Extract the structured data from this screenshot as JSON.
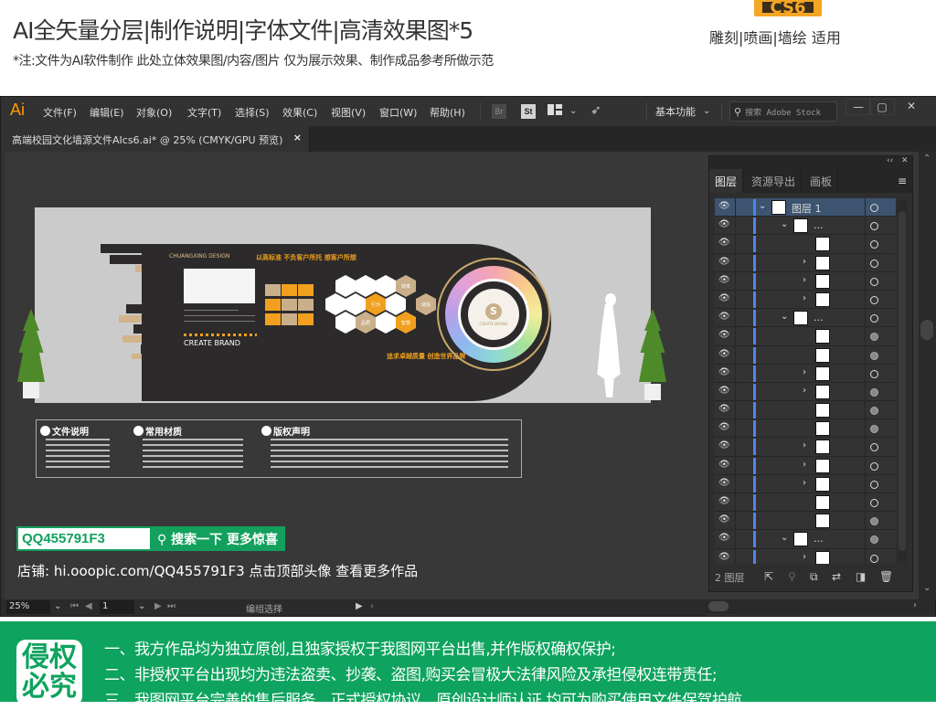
{
  "promo": {
    "title": "AI全矢量分层|制作说明|字体文件|高清效果图*5",
    "note": "*注:文件为AI软件制作 此处立体效果图/内容/图片 仅为展示效果、制作成品参考所做示范",
    "version_badge": "CS6",
    "usage": "雕刻|喷画|墙绘 适用"
  },
  "app": {
    "logo": "Ai",
    "menu": [
      "文件(F)",
      "编辑(E)",
      "对象(O)",
      "文字(T)",
      "选择(S)",
      "效果(C)",
      "视图(V)",
      "窗口(W)",
      "帮助(H)"
    ],
    "toolbar": {
      "bridge": "Br",
      "stock": "St",
      "workspace": "基本功能",
      "stock_search_placeholder": "搜索 Adobe Stock"
    },
    "window_controls": {
      "minimize": "—",
      "maximize": "▢",
      "close": "✕"
    },
    "document_tab": "高端校园文化墙源文件AIcs6.ai* @ 25% (CMYK/GPU 预览)",
    "document_tab_close": "×"
  },
  "artwork": {
    "brand_name": "CHUANGXING DESIGN",
    "slogan_top": "以高标准 不负客户所托 想客户所想",
    "slogan_bottom": "追求卓越质量 创造世界品牌",
    "create_brand": "CREATE BRAND",
    "ring_brand": "CREATE BRAND",
    "ring_logo": "S",
    "hex_labels": [
      "行为",
      "效率",
      "诚信",
      "品质",
      "智慧"
    ],
    "info_sections": [
      "文件说明",
      "常用材质",
      "版权声明"
    ]
  },
  "promo_overlay": {
    "qq_id": "QQ455791F3",
    "search_button": "搜索一下 更多惊喜",
    "shop_text": "店铺: hi.ooopic.com/QQ455791F3  点击顶部头像 查看更多作品"
  },
  "layers_panel": {
    "collapse": "‹‹",
    "close": "✕",
    "tabs": [
      "图层",
      "资源导出",
      "画板"
    ],
    "active_tab": "图层",
    "layers": [
      {
        "name": "图层 1",
        "indent": 0,
        "expand": "down",
        "selected": true,
        "target_filled": false
      },
      {
        "name": "...",
        "indent": 1,
        "expand": "down",
        "selected": false,
        "target_filled": false
      },
      {
        "name": "",
        "indent": 2,
        "expand": "",
        "selected": false,
        "target_filled": false
      },
      {
        "name": "",
        "indent": 2,
        "expand": "right",
        "selected": false,
        "target_filled": false
      },
      {
        "name": "",
        "indent": 2,
        "expand": "right",
        "selected": false,
        "target_filled": false
      },
      {
        "name": "",
        "indent": 2,
        "expand": "right",
        "selected": false,
        "target_filled": false
      },
      {
        "name": "...",
        "indent": 1,
        "expand": "down",
        "selected": false,
        "target_filled": false
      },
      {
        "name": "",
        "indent": 2,
        "expand": "",
        "selected": false,
        "target_filled": true
      },
      {
        "name": "",
        "indent": 2,
        "expand": "",
        "selected": false,
        "target_filled": true
      },
      {
        "name": "",
        "indent": 2,
        "expand": "right",
        "selected": false,
        "target_filled": false
      },
      {
        "name": "",
        "indent": 2,
        "expand": "right",
        "selected": false,
        "target_filled": true
      },
      {
        "name": "",
        "indent": 2,
        "expand": "",
        "selected": false,
        "target_filled": true
      },
      {
        "name": "",
        "indent": 2,
        "expand": "",
        "selected": false,
        "target_filled": true
      },
      {
        "name": "",
        "indent": 2,
        "expand": "right",
        "selected": false,
        "target_filled": false
      },
      {
        "name": "",
        "indent": 2,
        "expand": "right",
        "selected": false,
        "target_filled": false
      },
      {
        "name": "",
        "indent": 2,
        "expand": "right",
        "selected": false,
        "target_filled": false
      },
      {
        "name": "",
        "indent": 2,
        "expand": "",
        "selected": false,
        "target_filled": false
      },
      {
        "name": "",
        "indent": 2,
        "expand": "",
        "selected": false,
        "target_filled": true
      },
      {
        "name": "...",
        "indent": 1,
        "expand": "down",
        "selected": false,
        "target_filled": true
      },
      {
        "name": "",
        "indent": 2,
        "expand": "right",
        "selected": false,
        "target_filled": false
      }
    ],
    "layer_count": "2 图层"
  },
  "statusbar": {
    "zoom": "25%",
    "page": "1",
    "tool": "编组选择"
  },
  "banner": {
    "badge": "侵权必究",
    "lines": [
      "一、我方作品均为独立原创,且独家授权于我图网平台出售,并作版权确权保护;",
      "二、非授权平台出现均为违法盗卖、抄袭、盗图,购买会冒极大法律风险及承担侵权连带责任;",
      "三、我图网平台完善的售后服务、正式授权协议、原创设计师认证,均可为购买使用文件保驾护航。"
    ]
  },
  "colors": {
    "accent_green": "#0ea35e",
    "ai_orange": "#ff9a00",
    "layer_blue": "#4a86f0",
    "wall_orange": "#f0a01e",
    "wall_tan": "#c9b08a"
  }
}
